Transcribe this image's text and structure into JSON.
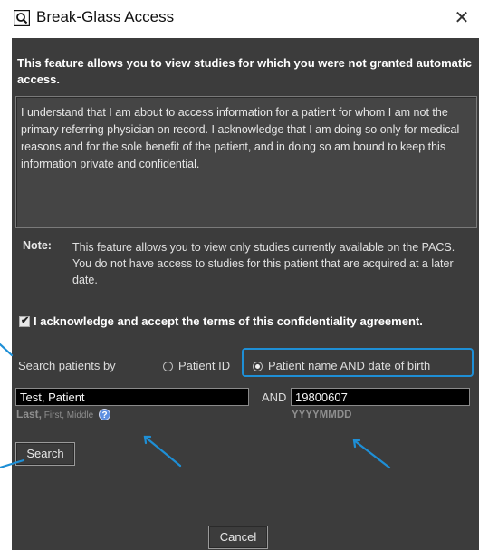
{
  "window": {
    "title": "Break-Glass Access",
    "close_glyph": "✕",
    "icon": "magnifier-window-icon"
  },
  "intro": {
    "text": "This feature allows you to view studies for which you were not granted automatic access."
  },
  "agreement": {
    "text": "I understand that I am about to access information for a patient for whom I am not the primary referring physician on record. I acknowledge that I am doing so only for medical reasons and for the sole benefit of the patient, and in doing so am bound to keep this information private and confidential."
  },
  "note": {
    "label": "Note:",
    "text": "This feature allows you to view only studies currently available on the PACS. You do not have access to studies for this patient that are acquired at a later date."
  },
  "acknowledge": {
    "label": "I acknowledge and accept the terms of this confidentiality agreement.",
    "checked": true
  },
  "search": {
    "by_label": "Search patients by",
    "options": [
      {
        "label": "Patient ID",
        "selected": false
      },
      {
        "label": "Patient name AND date of birth",
        "selected": true
      }
    ],
    "name_value": "Test, Patient",
    "and_label": "AND",
    "dob_value": "19800607",
    "name_hint_main": "Last,",
    "name_hint_small": " First, Middle",
    "help_glyph": "?",
    "dob_hint": "YYYYMMDD",
    "button_label": "Search"
  },
  "cancel_label": "Cancel",
  "colors": {
    "dialog_bg": "#3c3c3c",
    "highlight": "#1e8fd6",
    "input_bg": "#000000",
    "annotation_arrow": "#1e8fd6"
  }
}
